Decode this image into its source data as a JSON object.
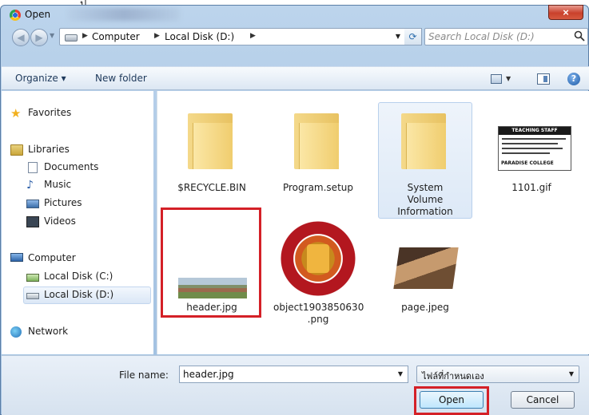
{
  "window": {
    "title": "Open",
    "close_glyph": "×"
  },
  "top_glyph": "ปุ",
  "navigation": {
    "back_glyph": "◀",
    "forward_glyph": "▶",
    "breadcrumb": [
      "Computer",
      "Local Disk (D:)"
    ],
    "search_placeholder": "Search Local Disk (D:)",
    "refresh_glyph": "⟳"
  },
  "toolbar": {
    "organize": "Organize ▾",
    "new_folder": "New folder",
    "help_glyph": "?"
  },
  "sidebar": {
    "favorites": "Favorites",
    "libraries": "Libraries",
    "documents": "Documents",
    "music": "Music",
    "pictures": "Pictures",
    "videos": "Videos",
    "computer": "Computer",
    "local_c": "Local Disk (C:)",
    "local_d": "Local Disk (D:)",
    "network": "Network"
  },
  "files": [
    {
      "name": "$RECYCLE.BIN",
      "kind": "folder"
    },
    {
      "name": "Program.setup",
      "kind": "folder"
    },
    {
      "name": "System Volume Information",
      "kind": "folder"
    },
    {
      "name": "1101.gif",
      "kind": "image"
    },
    {
      "name": "header.jpg",
      "kind": "image",
      "highlighted": true
    },
    {
      "name": "object1903850630 .png",
      "kind": "image"
    },
    {
      "name": "page.jpeg",
      "kind": "image"
    }
  ],
  "poster": {
    "title": "TEACHING STAFF REQUIRED",
    "college": "PARADISE COLLEGE"
  },
  "footer": {
    "file_name_label": "File name:",
    "file_name_value": "header.jpg",
    "file_type": "ไฟล์ที่กำหนดเอง",
    "open": "Open",
    "cancel": "Cancel"
  },
  "colors": {
    "highlight": "#d42027",
    "chrome": "#aac6e4"
  },
  "icons": [
    "app-icon",
    "back-icon",
    "forward-icon",
    "drive-icon",
    "refresh-icon",
    "search-icon",
    "view-icon",
    "preview-pane-icon",
    "help-icon",
    "star-icon",
    "library-icon",
    "document-icon",
    "music-icon",
    "pictures-icon",
    "videos-icon",
    "computer-icon",
    "disk-icon",
    "network-icon",
    "folder-icon"
  ]
}
